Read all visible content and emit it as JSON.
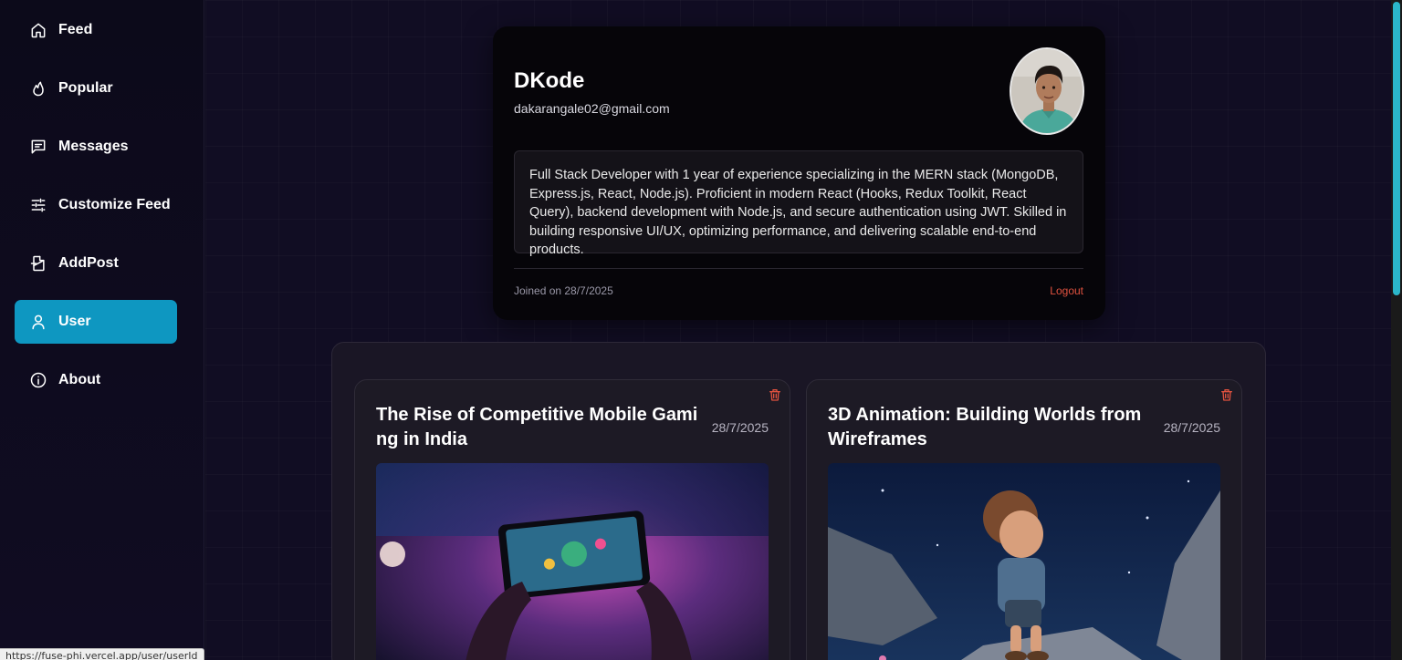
{
  "sidebar": {
    "items": [
      {
        "label": "Feed",
        "icon": "home-icon",
        "active": false
      },
      {
        "label": "Popular",
        "icon": "flame-icon",
        "active": false
      },
      {
        "label": "Messages",
        "icon": "message-icon",
        "active": false
      },
      {
        "label": "Customize Feed",
        "icon": "sliders-icon",
        "active": false
      },
      {
        "label": "AddPost",
        "icon": "file-plus-icon",
        "active": false
      },
      {
        "label": "User",
        "icon": "user-icon",
        "active": true
      },
      {
        "label": "About",
        "icon": "info-icon",
        "active": false
      }
    ],
    "active_color": "#0e97c1"
  },
  "profile": {
    "name": "DKode",
    "email": "dakarangale02@gmail.com",
    "bio": "Full Stack Developer with 1 year of experience specializing in the MERN stack (MongoDB, Express.js, React, Node.js). Proficient in modern React (Hooks, Redux Toolkit, React Query), backend development with Node.js, and secure authentication using JWT. Skilled in building responsive UI/UX, optimizing performance, and delivering scalable end-to-end products.",
    "joined": "Joined on 28/7/2025",
    "logout_label": "Logout"
  },
  "posts": [
    {
      "title": "The Rise of Competitive Mobile Gaming in India",
      "date": "28/7/2025",
      "image": "mobile-gaming-photo"
    },
    {
      "title": "3D Animation: Building Worlds from Wireframes",
      "date": "28/7/2025",
      "image": "3d-animated-boy-photo"
    }
  ],
  "status_bar": {
    "url": "https://fuse-phi.vercel.app/user/userId"
  },
  "colors": {
    "accent": "#0e97c1",
    "danger": "#e0523f",
    "background": "#110d23"
  }
}
